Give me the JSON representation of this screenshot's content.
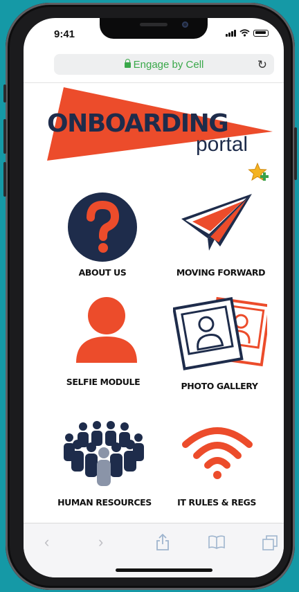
{
  "status_bar": {
    "time": "9:41"
  },
  "browser": {
    "url_text": "Engage by Cell"
  },
  "logo": {
    "title": "ONBOARDING",
    "subtitle": "portal"
  },
  "tiles": [
    {
      "label": "ABOUT US",
      "icon": "question-mark-icon"
    },
    {
      "label": "MOVING FORWARD",
      "icon": "paper-plane-icon"
    },
    {
      "label": "SELFIE MODULE",
      "icon": "person-icon"
    },
    {
      "label": "PHOTO GALLERY",
      "icon": "photo-frames-icon"
    },
    {
      "label": "HUMAN RESOURCES",
      "icon": "crowd-icon"
    },
    {
      "label": "IT RULES & REGS",
      "icon": "wifi-icon"
    }
  ],
  "colors": {
    "accent": "#ec4c2b",
    "navy": "#1e2c4b",
    "url_green": "#3aa84a",
    "background": "#1599a6"
  }
}
